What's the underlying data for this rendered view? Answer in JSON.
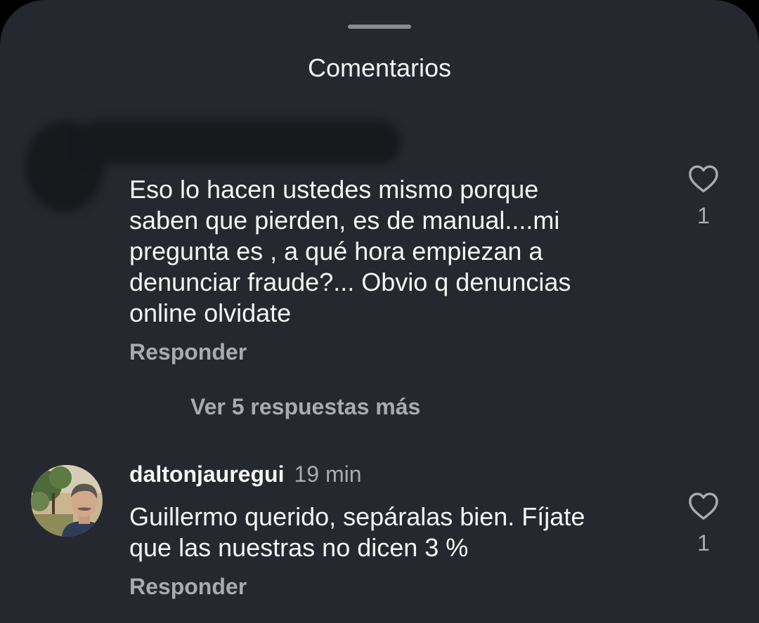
{
  "sheet": {
    "title": "Comentarios"
  },
  "comments": [
    {
      "username": "",
      "text": "Eso lo hacen ustedes mismo porque\nsaben que pierden, es de manual....mi\npregunta es , a qué hora empiezan a\ndenunciar fraude?... Obvio q denuncias\nonline olvidate",
      "reply_label": "Responder",
      "like_count": "1",
      "view_replies_label": "Ver 5 respuestas más",
      "redacted": true
    },
    {
      "username": "daltonjauregui",
      "timestamp": "19 min",
      "text": "Guillermo querido, sepáralas bien. Fíjate\nque las nuestras no dicen 3 %",
      "reply_label": "Responder",
      "like_count": "1"
    }
  ],
  "icons": {
    "like": "heart-outline-icon",
    "grabber": "drag-handle"
  },
  "colors": {
    "sheet_background": "#25282e",
    "primary_text": "#f5f5f5",
    "secondary_text": "#a8abb1",
    "redaction": "#17191d"
  }
}
